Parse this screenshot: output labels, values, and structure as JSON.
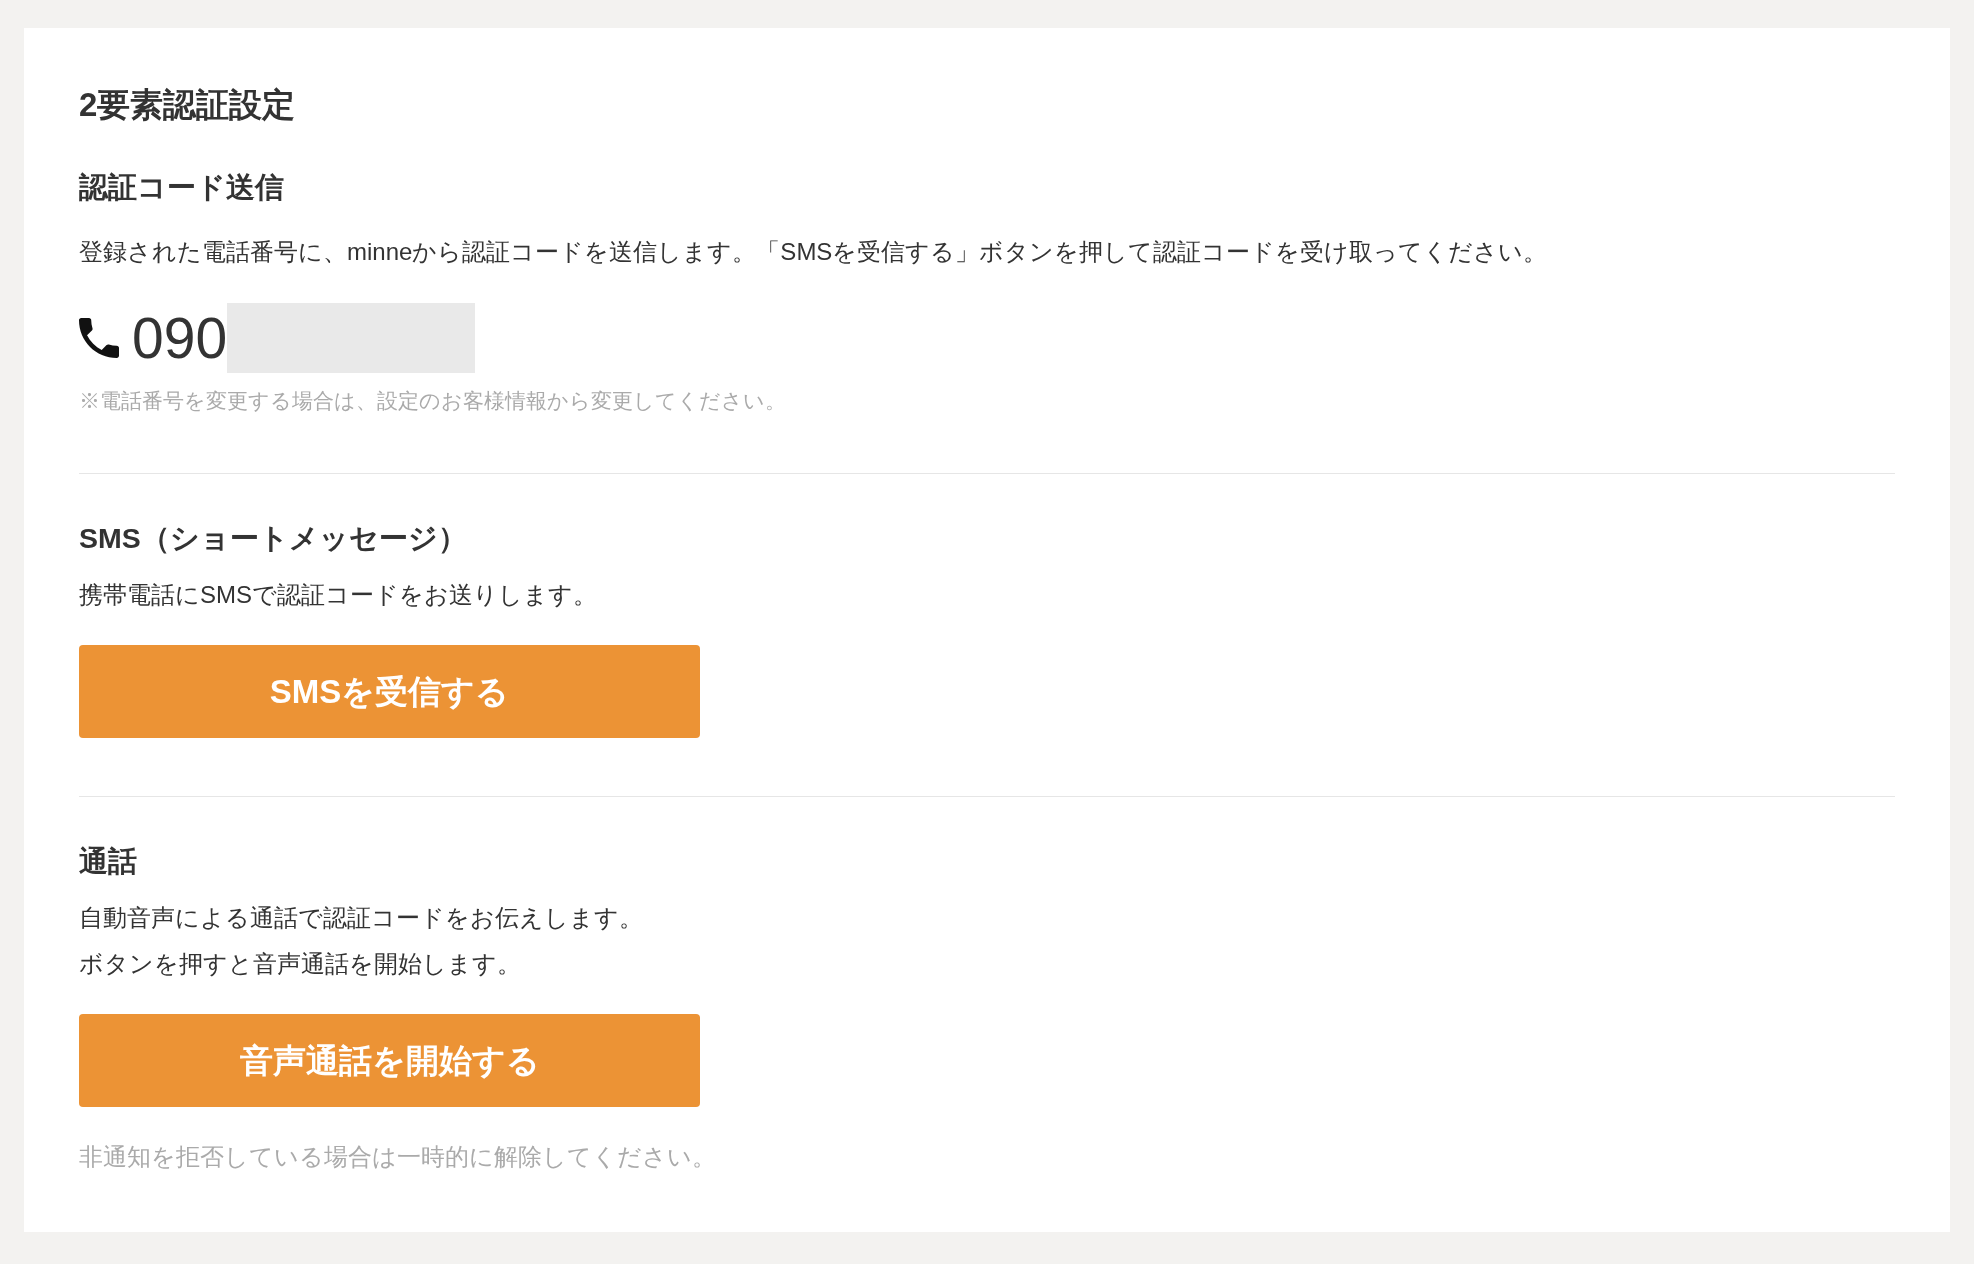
{
  "page": {
    "title": "2要素認証設定"
  },
  "sections": [
    {
      "kind": "info",
      "heading": "認証コード送信",
      "paragraphs": [
        "登録された電話番号に、minneから認証コードを送信します。「SMSを受信する」ボタンを押して認証コードを受け取ってください。"
      ],
      "phone": {
        "number": "090"
      },
      "note": "※電話番号を変更する場合は、設定のお客様情報から変更してください。"
    },
    {
      "kind": "method",
      "heading": "SMS（ショートメッセージ）",
      "paragraphs": [
        "携帯電話にSMSで認証コードをお送りします。"
      ],
      "button": "SMSを受信する"
    },
    {
      "kind": "method",
      "heading": "通話",
      "paragraphs": [
        "自動音声による通話で認証コードをお伝えします。",
        "ボタンを押すと音声通話を開始します。"
      ],
      "button": "音声通話を開始する",
      "note": "非通知を拒否している場合は一時的に解除してください。"
    }
  ]
}
